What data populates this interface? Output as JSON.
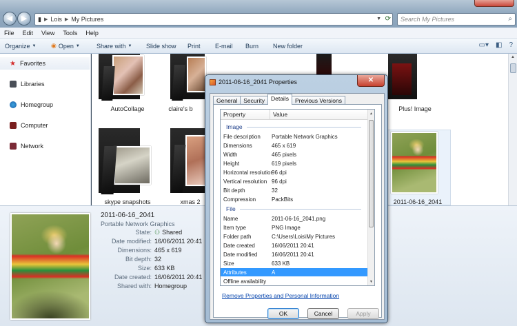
{
  "window": {
    "breadcrumb": [
      "Lois",
      "My Pictures"
    ],
    "search_placeholder": "Search My Pictures"
  },
  "menu": [
    "File",
    "Edit",
    "View",
    "Tools",
    "Help"
  ],
  "toolbar": {
    "organize": "Organize",
    "open": "Open",
    "share_with": "Share with",
    "slide_show": "Slide show",
    "print": "Print",
    "email": "E-mail",
    "burn": "Burn",
    "new_folder": "New folder"
  },
  "nav": {
    "favorites": "Favorites",
    "libraries": "Libraries",
    "homegroup": "Homegroup",
    "computer": "Computer",
    "network": "Network"
  },
  "items": {
    "autocollage": "AutoCollage",
    "claires": "claire's b",
    "plus_image": "Plus! Image",
    "skype": "skype snapshots",
    "xmas": "xmas 2",
    "photo": "2011-06-16_2041"
  },
  "details_pane": {
    "name": "2011-06-16_2041",
    "type": "Portable Network Graphics",
    "rows": [
      {
        "k": "State:",
        "v": "Shared"
      },
      {
        "k": "Date modified:",
        "v": "16/06/2011 20:41"
      },
      {
        "k": "Dimensions:",
        "v": "465 x 619"
      },
      {
        "k": "Bit depth:",
        "v": "32"
      },
      {
        "k": "Size:",
        "v": "633 KB"
      },
      {
        "k": "Date created:",
        "v": "16/06/2011 20:41"
      },
      {
        "k": "Shared with:",
        "v": "Homegroup"
      }
    ]
  },
  "dialog": {
    "title": "2011-06-16_2041 Properties",
    "tabs": [
      "General",
      "Security",
      "Details",
      "Previous Versions"
    ],
    "col_property": "Property",
    "col_value": "Value",
    "group_image": "Image",
    "image_rows": [
      {
        "k": "File description",
        "v": "Portable Network Graphics"
      },
      {
        "k": "Dimensions",
        "v": "465 x 619"
      },
      {
        "k": "Width",
        "v": "465 pixels"
      },
      {
        "k": "Height",
        "v": "619 pixels"
      },
      {
        "k": "Horizontal resolution",
        "v": "96 dpi"
      },
      {
        "k": "Vertical resolution",
        "v": "96 dpi"
      },
      {
        "k": "Bit depth",
        "v": "32"
      },
      {
        "k": "Compression",
        "v": "PackBits"
      }
    ],
    "group_file": "File",
    "file_rows": [
      {
        "k": "Name",
        "v": "2011-06-16_2041.png"
      },
      {
        "k": "Item type",
        "v": "PNG Image"
      },
      {
        "k": "Folder path",
        "v": "C:\\Users\\Lois\\My Pictures"
      },
      {
        "k": "Date created",
        "v": "16/06/2011 20:41"
      },
      {
        "k": "Date modified",
        "v": "16/06/2011 20:41"
      },
      {
        "k": "Size",
        "v": "633 KB"
      },
      {
        "k": "Attributes",
        "v": "A"
      },
      {
        "k": "Offline availability",
        "v": ""
      }
    ],
    "remove_link": "Remove Properties and Personal Information",
    "ok": "OK",
    "cancel": "Cancel",
    "apply": "Apply"
  }
}
